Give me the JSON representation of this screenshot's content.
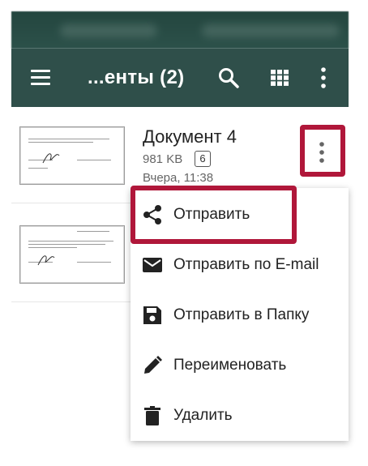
{
  "appbar": {
    "title": "...енты (2)",
    "menu_icon": "hamburger-menu-icon",
    "search_icon": "search-icon",
    "grid_icon": "grid-view-icon",
    "more_icon": "more-vertical-icon",
    "background": "#2f4f4a"
  },
  "documents": [
    {
      "title": "Документ 4",
      "size": "981 KB",
      "pages": "6",
      "date": "Вчера, 11:38"
    },
    {
      "title": "",
      "size": "",
      "pages": "",
      "date": ""
    }
  ],
  "context_menu": {
    "items": [
      {
        "label": "Отправить",
        "icon": "share-icon"
      },
      {
        "label": "Отправить по E-mail",
        "icon": "email-icon"
      },
      {
        "label": "Отправить в Папку",
        "icon": "save-icon"
      },
      {
        "label": "Переименовать",
        "icon": "edit-pencil-icon"
      },
      {
        "label": "Удалить",
        "icon": "trash-icon"
      }
    ]
  },
  "highlight_color": "#b0173a"
}
